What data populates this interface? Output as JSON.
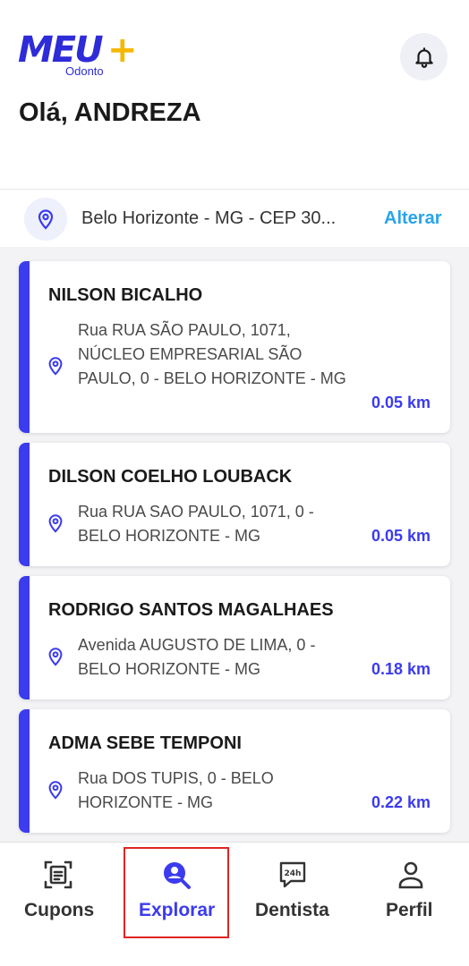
{
  "header": {
    "logo_main": "MEU",
    "logo_plus": "+",
    "logo_sub": "Odonto",
    "greeting": "Olá, ANDREZA",
    "bell_icon": "bell-icon"
  },
  "location": {
    "icon": "map-pin-icon",
    "text": "Belo Horizonte - MG - CEP 30...",
    "change_label": "Alterar"
  },
  "dentists": [
    {
      "name": "NILSON BICALHO",
      "address": "Rua RUA SÃO PAULO, 1071, NÚCLEO EMPRESARIAL SÃO PAULO, 0 - BELO HORIZONTE - MG",
      "distance": "0.05 km"
    },
    {
      "name": "DILSON COELHO LOUBACK",
      "address": "Rua RUA SAO PAULO, 1071, 0 - BELO HORIZONTE - MG",
      "distance": "0.05 km"
    },
    {
      "name": "RODRIGO SANTOS MAGALHAES",
      "address": "Avenida AUGUSTO DE LIMA, 0 - BELO HORIZONTE - MG",
      "distance": "0.18 km"
    },
    {
      "name": "ADMA SEBE TEMPONI",
      "address": "Rua DOS TUPIS, 0 - BELO HORIZONTE - MG",
      "distance": "0.22 km"
    }
  ],
  "nav": {
    "items": [
      {
        "label": "Cupons",
        "icon": "coupon-scan-icon",
        "active": false
      },
      {
        "label": "Explorar",
        "icon": "search-user-icon",
        "active": true
      },
      {
        "label": "Dentista",
        "icon": "24h-chat-icon",
        "active": false
      },
      {
        "label": "Perfil",
        "icon": "person-icon",
        "active": false
      }
    ]
  },
  "colors": {
    "brand": "#2e2bd8",
    "accent": "#3b3bf0",
    "link": "#2aa4e8",
    "plus": "#f5b800",
    "highlight": "#e02424"
  }
}
